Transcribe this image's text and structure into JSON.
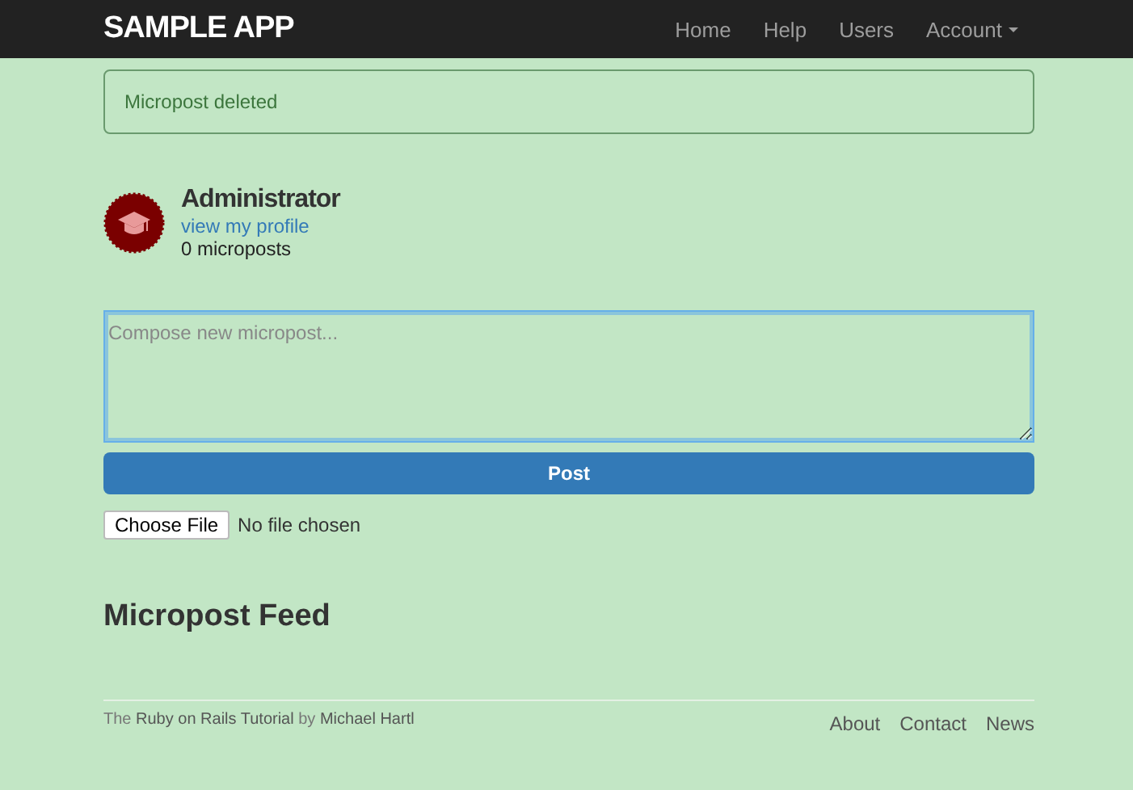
{
  "navbar": {
    "logo": "SAMPLE APP",
    "links": [
      {
        "label": "Home",
        "kind": "link"
      },
      {
        "label": "Help",
        "kind": "link"
      },
      {
        "label": "Users",
        "kind": "link"
      },
      {
        "label": "Account",
        "kind": "dropdown"
      }
    ]
  },
  "flash": {
    "message": "Micropost deleted"
  },
  "user": {
    "name": "Administrator",
    "profile_link": "view my profile",
    "count": "0 microposts"
  },
  "compose": {
    "placeholder": "Compose new micropost...",
    "post_button": "Post",
    "file_button": "Choose File",
    "file_status": "No file chosen"
  },
  "feed": {
    "title": "Micropost Feed"
  },
  "footer": {
    "text_before": "The",
    "link_1": "Ruby on Rails Tutorial",
    "text_middle": "by",
    "link_2": "Michael Hartl",
    "links": [
      "About",
      "Contact",
      "News"
    ]
  }
}
